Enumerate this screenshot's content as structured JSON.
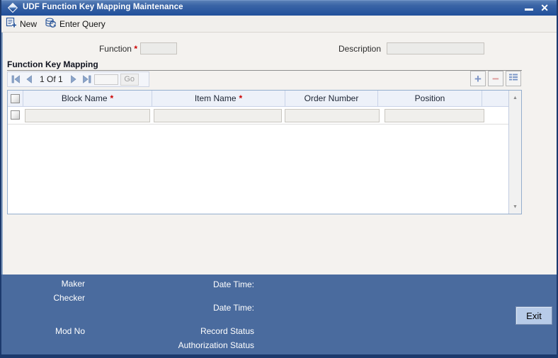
{
  "window": {
    "title": "UDF Function Key Mapping Maintenance"
  },
  "icons": {
    "close": "✕",
    "scroll_up": "▲",
    "scroll_down": "▼",
    "add": "+",
    "remove": "−"
  },
  "marks": {
    "required": "*"
  },
  "toolbar": {
    "new_label": "New",
    "enter_query_label": "Enter Query"
  },
  "form": {
    "function_label": "Function",
    "function_value": "",
    "description_label": "Description",
    "description_value": ""
  },
  "section": {
    "title": "Function Key Mapping"
  },
  "pagination": {
    "page_text": "1 Of 1",
    "page_input_value": "",
    "go_label": "Go"
  },
  "table": {
    "columns": [
      {
        "label": "Block Name",
        "required": true
      },
      {
        "label": "Item Name",
        "required": true
      },
      {
        "label": "Order Number",
        "required": false
      },
      {
        "label": "Position",
        "required": false
      }
    ],
    "rows": [
      {
        "block_name": "",
        "item_name": "",
        "order_number": "",
        "position": ""
      }
    ]
  },
  "footer": {
    "maker_label": "Maker",
    "checker_label": "Checker",
    "mod_no_label": "Mod No",
    "date_time_label_1": "Date Time:",
    "date_time_label_2": "Date Time:",
    "record_status_label": "Record Status",
    "authorization_status_label": "Authorization Status",
    "exit_label": "Exit"
  },
  "colors": {
    "window_border": "#1c3a6d",
    "title_bar_gradient_top": "#4a74ae",
    "title_bar_gradient_bottom": "#21509b",
    "footer_background": "#4a6b9e",
    "table_header_background": "#edf1f9",
    "required_red": "#cc0000",
    "accent_blue": "#8aa4cc"
  }
}
